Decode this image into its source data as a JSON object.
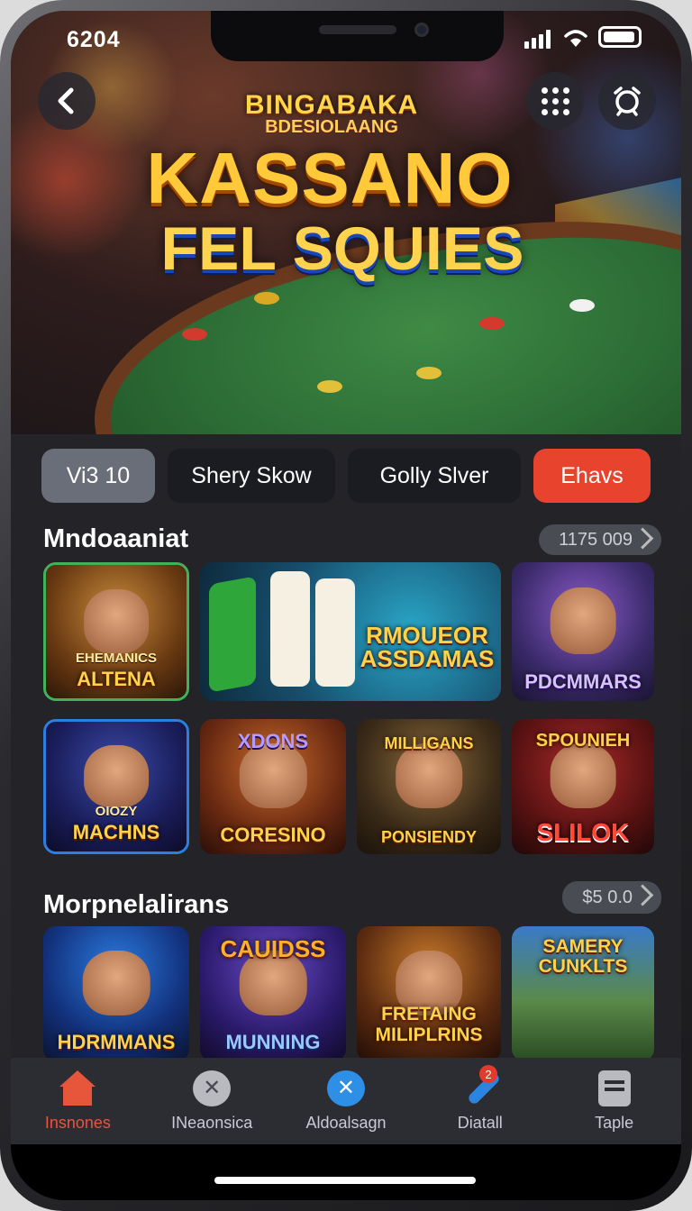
{
  "status_bar": {
    "time": "6204"
  },
  "hero": {
    "title_small_1": "BINGABAKA",
    "title_small_2": "BDESIOLAANG",
    "title_big_1": "KASSANO",
    "title_big_2": "FEL SQUIES"
  },
  "tabs": [
    {
      "label": "Vi3 10",
      "active": true
    },
    {
      "label": "Shery Skow",
      "active": false
    },
    {
      "label": "Golly Slver",
      "active": false
    },
    {
      "label": "Ehavs",
      "active": false,
      "accent": "#e8432c"
    }
  ],
  "section1": {
    "title": "Mndoaaniat",
    "badge": "1175 009",
    "cards": [
      {
        "sub": "EHEMANICS",
        "label": "ALTENA"
      },
      {
        "sub": "",
        "label": "RMOUEOR ASSDAMAS"
      },
      {
        "sub": "",
        "label": "PDCMMARS"
      },
      {
        "sub": "OIOZY",
        "label": "MACHNS"
      },
      {
        "sub": "",
        "label": "CORESINO",
        "top": "XDONS"
      },
      {
        "sub": "",
        "label": "PONSIENDY",
        "top": "MILLIGANS"
      },
      {
        "sub": "",
        "label": "SLILOK",
        "top": "SPOUNIEH"
      }
    ]
  },
  "section2": {
    "title": "Morpnelalirans",
    "badge": "$5 0.0",
    "cards": [
      {
        "label": "HDRMMANS"
      },
      {
        "top": "CAUIDSS",
        "label": "MUNNING"
      },
      {
        "label": "FRETAING MILIPLRINS"
      },
      {
        "top": "SAMERY CUNKLTS",
        "label": ""
      }
    ]
  },
  "nav": {
    "items": [
      {
        "label": "Insnones",
        "icon": "home-icon",
        "active": true
      },
      {
        "label": "INeaonsica",
        "icon": "x-badge-icon",
        "active": false
      },
      {
        "label": "Aldoalsagn",
        "icon": "x-circle-icon",
        "active": false
      },
      {
        "label": "Diatall",
        "icon": "joystick-icon",
        "active": false
      },
      {
        "label": "Taple",
        "icon": "doc-icon",
        "active": false
      }
    ],
    "notification_count": "2"
  },
  "colors": {
    "accent": "#e8432c",
    "background": "#232328",
    "nav_active": "#e7553a"
  }
}
